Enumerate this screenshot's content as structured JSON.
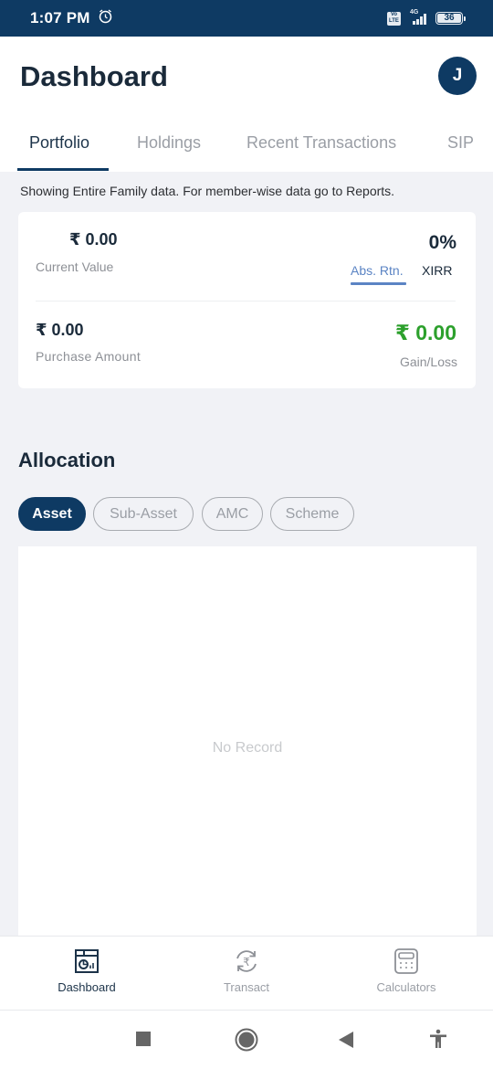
{
  "status_bar": {
    "time": "1:07 PM",
    "alarm_icon": "alarm-clock-icon",
    "volte": "Vo LTE",
    "network": "4G",
    "battery": "36"
  },
  "header": {
    "title": "Dashboard",
    "avatar_initial": "J"
  },
  "tabs": [
    {
      "label": "Portfolio",
      "active": true
    },
    {
      "label": "Holdings",
      "active": false
    },
    {
      "label": "Recent Transactions",
      "active": false
    },
    {
      "label": "SIP",
      "active": false
    }
  ],
  "info_text": "Showing Entire Family data. For member-wise data go to Reports.",
  "summary": {
    "current_value": "₹ 0.00",
    "current_value_label": "Current Value",
    "return_value": "0%",
    "return_tabs": [
      {
        "label": "Abs. Rtn.",
        "active": true
      },
      {
        "label": "XIRR",
        "active": false
      }
    ],
    "purchase_amount": "₹ 0.00",
    "purchase_amount_label": "Purchase Amount",
    "gain_loss": "₹ 0.00",
    "gain_loss_label": "Gain/Loss",
    "gain_color": "#2ca02c"
  },
  "allocation": {
    "title": "Allocation",
    "chips": [
      {
        "label": "Asset",
        "active": true
      },
      {
        "label": "Sub-Asset",
        "active": false
      },
      {
        "label": "AMC",
        "active": false
      },
      {
        "label": "Scheme",
        "active": false
      }
    ],
    "empty_text": "No Record"
  },
  "bottom_nav": [
    {
      "label": "Dashboard",
      "icon": "dashboard-icon",
      "active": true
    },
    {
      "label": "Transact",
      "icon": "rupee-exchange-icon",
      "active": false
    },
    {
      "label": "Calculators",
      "icon": "calculator-icon",
      "active": false
    }
  ],
  "system_nav": [
    "recents-icon",
    "home-icon",
    "back-icon",
    "accessibility-icon"
  ],
  "colors": {
    "brand": "#0e3a63",
    "accent_link": "#5b84c4",
    "gain": "#2ca02c",
    "background": "#f1f2f6"
  }
}
